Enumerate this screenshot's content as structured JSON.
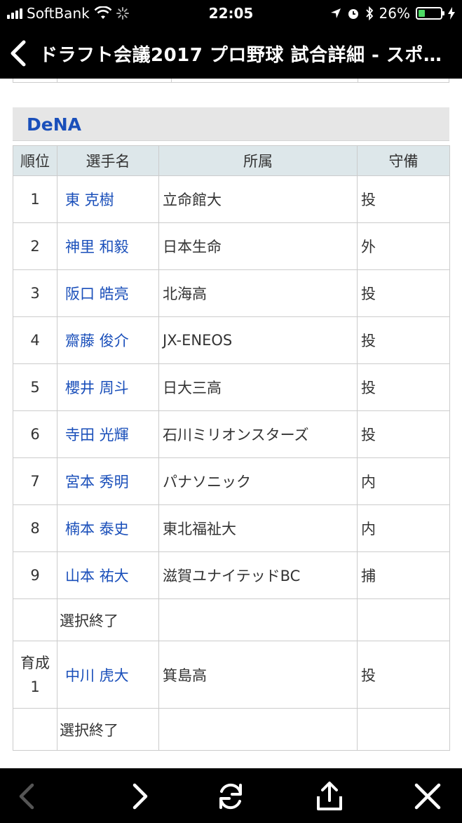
{
  "status_bar": {
    "carrier": "SoftBank",
    "time": "22:05",
    "battery_percent": "26%",
    "battery_level": 0.26
  },
  "nav": {
    "title": "ドラフト会議2017 プロ野球 試合詳細 - スポ…"
  },
  "team": {
    "name": "DeNA"
  },
  "table": {
    "headers": [
      "順位",
      "選手名",
      "所属",
      "守備"
    ],
    "rows": [
      {
        "rank": "1",
        "player": "東 克樹",
        "affiliation": "立命館大",
        "position": "投"
      },
      {
        "rank": "2",
        "player": "神里 和毅",
        "affiliation": "日本生命",
        "position": "外"
      },
      {
        "rank": "3",
        "player": "阪口 皓亮",
        "affiliation": "北海高",
        "position": "投"
      },
      {
        "rank": "4",
        "player": "齋藤 俊介",
        "affiliation": "JX-ENEOS",
        "position": "投"
      },
      {
        "rank": "5",
        "player": "櫻井 周斗",
        "affiliation": "日大三高",
        "position": "投"
      },
      {
        "rank": "6",
        "player": "寺田 光輝",
        "affiliation": "石川ミリオンスターズ",
        "position": "投"
      },
      {
        "rank": "7",
        "player": "宮本 秀明",
        "affiliation": "パナソニック",
        "position": "内"
      },
      {
        "rank": "8",
        "player": "楠本 泰史",
        "affiliation": "東北福祉大",
        "position": "内"
      },
      {
        "rank": "9",
        "player": "山本 祐大",
        "affiliation": "滋賀ユナイテッドBC",
        "position": "捕"
      }
    ],
    "selection_end_1": "選択終了",
    "ikusei": {
      "rank_line1": "育成",
      "rank_line2": "1",
      "player": "中川 虎大",
      "affiliation": "箕島高",
      "position": "投"
    },
    "selection_end_2": "選択終了"
  },
  "colors": {
    "link": "#1a4fba",
    "header_bg": "#dde7ea",
    "team_bar_bg": "#e6e6e6",
    "bars": "#000000"
  },
  "toolbar": {
    "icons": [
      "chevron-left-icon",
      "chevron-right-icon",
      "reload-icon",
      "share-icon",
      "close-icon"
    ]
  }
}
